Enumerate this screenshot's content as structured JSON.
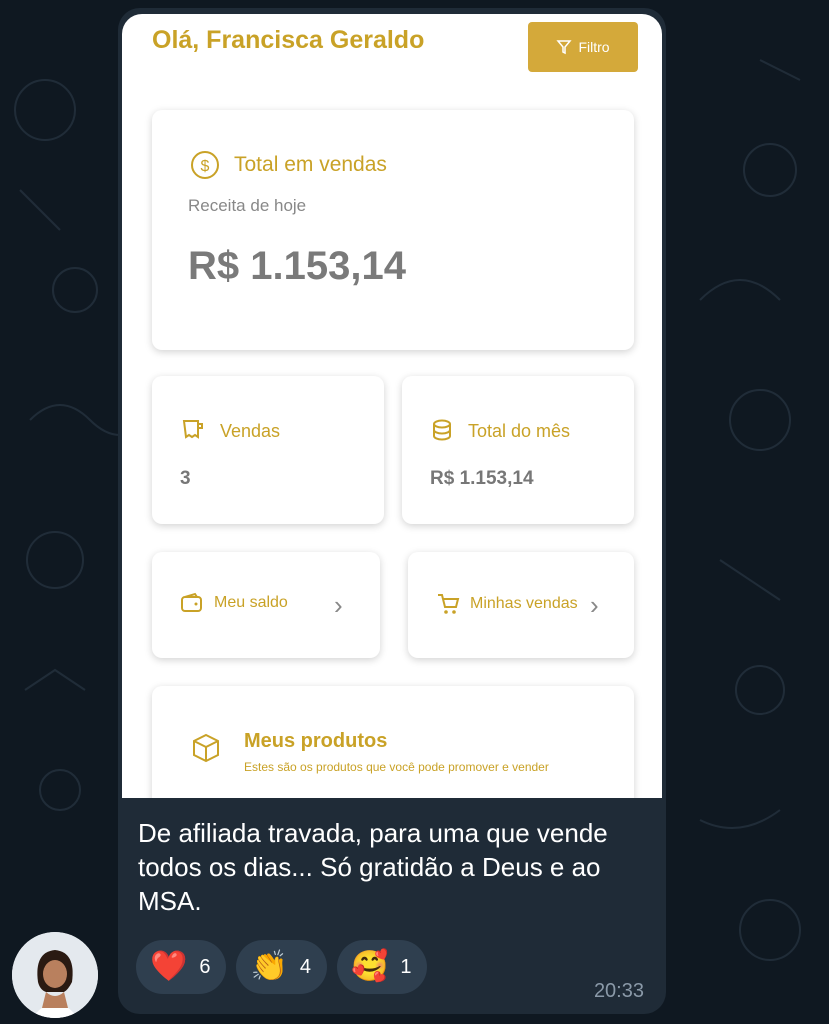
{
  "screenshot": {
    "greeting": "Olá, Francisca Geraldo",
    "filter_label": "Filtro",
    "total_card": {
      "title": "Total em vendas",
      "subtitle": "Receita de hoje",
      "value": "R$ 1.153,14"
    },
    "vendas_card": {
      "title": "Vendas",
      "value": "3"
    },
    "mes_card": {
      "title": "Total do mês",
      "value": "R$ 1.153,14"
    },
    "saldo_link": {
      "label": "Meu saldo"
    },
    "minhas_link": {
      "label": "Minhas vendas"
    },
    "produtos_card": {
      "title": "Meus produtos",
      "subtitle": "Estes são os produtos que você pode promover e vender"
    }
  },
  "message": {
    "text": "De afiliada travada, para uma que vende todos os dias... Só gratidão a Deus e ao MSA.",
    "time": "20:33"
  },
  "reactions": [
    {
      "emoji": "❤️",
      "count": "6"
    },
    {
      "emoji": "👏",
      "count": "4"
    },
    {
      "emoji": "🥰",
      "count": "1"
    }
  ],
  "colors": {
    "accent": "#c9a227",
    "bubble": "#1f2b37",
    "background": "#0f1821"
  }
}
